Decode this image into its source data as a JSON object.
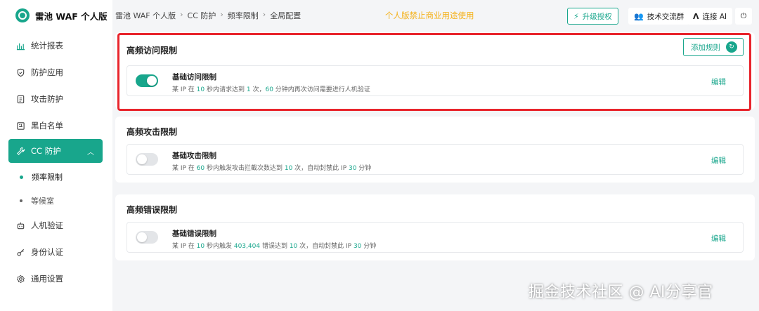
{
  "brand": {
    "name": "雷池 WAF 个人版"
  },
  "sidebar": {
    "items": [
      {
        "label": "统计报表",
        "icon": "bar-chart-icon"
      },
      {
        "label": "防护应用",
        "icon": "shield-icon"
      },
      {
        "label": "攻击防护",
        "icon": "document-icon"
      },
      {
        "label": "黑白名单",
        "icon": "list-icon"
      },
      {
        "label": "CC 防护",
        "icon": "wrench-icon",
        "active": true,
        "expanded": true
      },
      {
        "label": "人机验证",
        "icon": "robot-icon"
      },
      {
        "label": "身份认证",
        "icon": "key-icon"
      },
      {
        "label": "通用设置",
        "icon": "gear-icon"
      }
    ],
    "sub_items": [
      {
        "label": "频率限制",
        "active": true
      },
      {
        "label": "等候室",
        "active": false
      }
    ]
  },
  "header": {
    "breadcrumbs": [
      "雷池 WAF 个人版",
      "CC 防护",
      "频率限制",
      "全局配置"
    ],
    "notice": "个人版禁止商业用途使用",
    "upgrade_label": "升级授权",
    "group_label": "技术交流群",
    "ai_label": "连接 AI"
  },
  "sections": [
    {
      "title": "高频访问限制",
      "add_rule_label": "添加规则",
      "rule": {
        "name": "基础访问限制",
        "enabled": true,
        "desc": {
          "p1": "某 IP 在 ",
          "v1": "10",
          "p2": " 秒内请求达到 ",
          "v2": "1",
          "p3": " 次，",
          "v3": "60",
          "p4": " 分钟内再次访问需要进行人机验证"
        },
        "edit_label": "编辑"
      }
    },
    {
      "title": "高频攻击限制",
      "rule": {
        "name": "基础攻击限制",
        "enabled": false,
        "desc": {
          "p1": "某 IP 在 ",
          "v1": "60",
          "p2": " 秒内触发攻击拦截次数达到 ",
          "v2": "10",
          "p3": " 次，自动封禁此 IP ",
          "v3": "30",
          "p4": " 分钟"
        },
        "edit_label": "编辑"
      }
    },
    {
      "title": "高频错误限制",
      "rule": {
        "name": "基础错误限制",
        "enabled": false,
        "desc": {
          "p1": "某 IP 在 ",
          "v1": "10",
          "p2": " 秒内触发 ",
          "v2": "403,404",
          "p3": " 错误达到 ",
          "v3": "10",
          "p4": " 次，自动封禁此 IP ",
          "v4": "30",
          "p5": " 分钟"
        },
        "edit_label": "编辑"
      }
    }
  ],
  "watermark": "掘金技术社区 @ AI分享官",
  "colors": {
    "accent": "#18a68c",
    "notice": "#f5b21d",
    "highlight": "#e8242c"
  }
}
